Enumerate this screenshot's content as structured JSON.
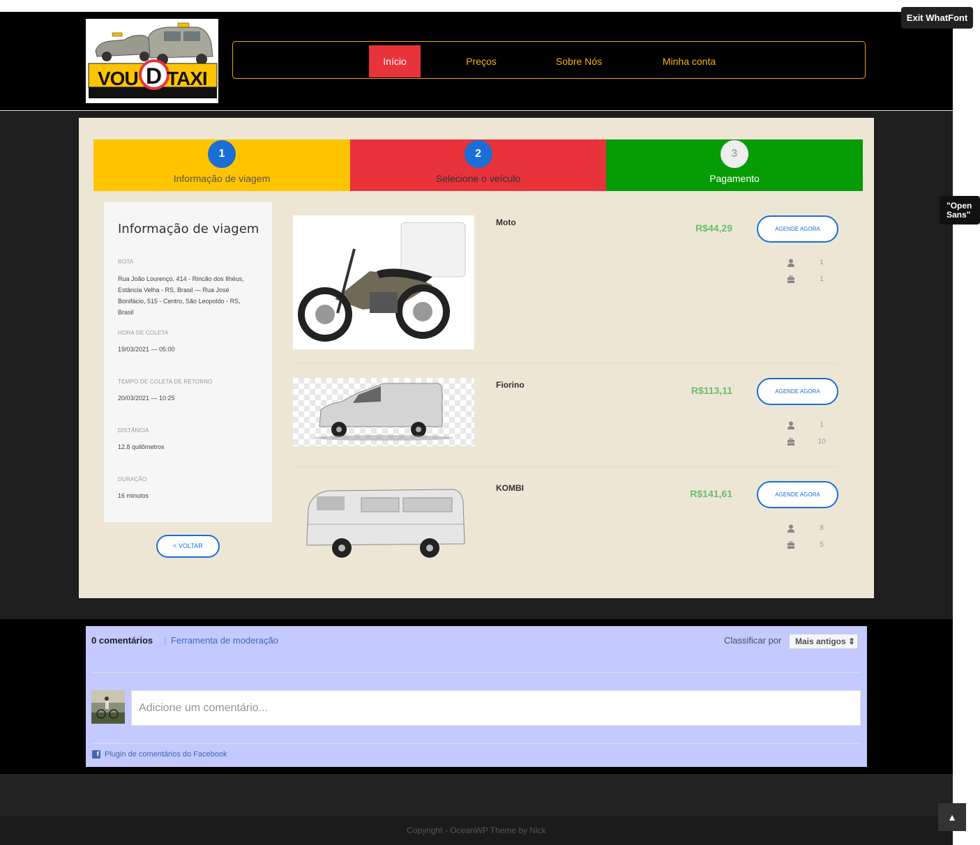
{
  "colors": {
    "accent_red": "#e8333a",
    "accent_yellow": "#ffc400",
    "accent_green": "#059c05",
    "nav_text": "#f7b500",
    "blue": "#1a6ed6",
    "price_green": "#6bbf6b"
  },
  "logo": {
    "text_left": "VOU",
    "text_d": "D",
    "text_right": "TAXI"
  },
  "nav": {
    "items": [
      "Início",
      "Preços",
      "Sobre Nós",
      "Minha conta"
    ]
  },
  "whatfont": {
    "exit": "Exit WhatFont",
    "tooltip": "\"Open Sans\""
  },
  "steps": [
    {
      "num": "1",
      "label": "Informação de viagem"
    },
    {
      "num": "2",
      "label": "Selecione o veículo"
    },
    {
      "num": "3",
      "label": "Pagamento"
    }
  ],
  "trip": {
    "title": "Informação de viagem",
    "route_label": "ROTA",
    "route": "Rua João Lourenço, 414 - Rincão dos Ilhéus, Estância Velha - RS, Brasil — Rua José Bonifácio, 515 - Centro, São Leopoldo - RS, Brasil",
    "pickup_label": "HORA DE COLETA",
    "pickup": "19/03/2021 — 05:00",
    "return_label": "TEMPO DE COLETA DE RETORNO",
    "return": "20/03/2021 — 10:25",
    "distance_label": "DISTÂNCIA",
    "distance": "12.8 quilômetros",
    "duration_label": "DURAÇÃO",
    "duration": "16 minutos",
    "back": "< VOLTAR"
  },
  "vehicles": [
    {
      "name": "Moto",
      "price": "R$44,29",
      "button": "AGENDE AGORA",
      "passengers": "1",
      "luggage": "1"
    },
    {
      "name": "Fiorino",
      "price": "R$113,11",
      "button": "AGENDE AGORA",
      "passengers": "1",
      "luggage": "10"
    },
    {
      "name": "KOMBI",
      "price": "R$141,61",
      "button": "AGENDE AGORA",
      "passengers": "8",
      "luggage": "5"
    }
  ],
  "comments": {
    "count": "0 comentários",
    "separator": "|",
    "moderation": "Ferramenta de moderação",
    "sort_label": "Classificar por",
    "sort_value": "Mais antigos ⇕",
    "placeholder": "Adicione um comentário...",
    "plugin": "Plugin de comentários do Facebook",
    "fb_letter": "f"
  },
  "footer": {
    "copyright": "Copyright - OceanWP Theme by Nick",
    "to_top": "▲"
  }
}
